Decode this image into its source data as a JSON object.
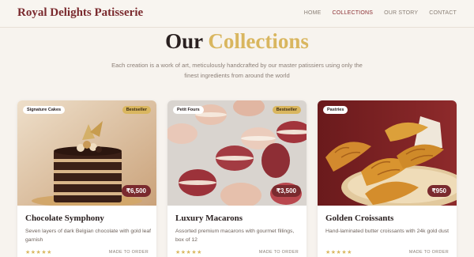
{
  "nav": {
    "brand": "Royal Delights Patisserie",
    "links": [
      {
        "label": "HOME",
        "active": false
      },
      {
        "label": "COLLECTIONS",
        "active": true
      },
      {
        "label": "OUR STORY",
        "active": false
      },
      {
        "label": "CONTACT",
        "active": false
      }
    ]
  },
  "hero": {
    "title_main": "Our",
    "title_accent": "Collections",
    "subtitle": "Each creation is a work of art, meticulously handcrafted by our master patissiers using only the finest ingredients from around the world"
  },
  "colors": {
    "brand": "#7a2a2e",
    "accent_gold": "#d9b65f",
    "background": "#f7f3ee"
  },
  "cards": [
    {
      "category": "Signature Cakes",
      "badge": "Bestseller",
      "price": "₹6,500",
      "name": "Chocolate Symphony",
      "description": "Seven layers of dark Belgian chocolate with gold leaf garnish",
      "rating": 5,
      "stars": "★★★★★",
      "cta": "MADE TO ORDER"
    },
    {
      "category": "Petit Fours",
      "badge": "Bestseller",
      "price": "₹3,500",
      "name": "Luxury Macarons",
      "description": "Assorted premium macarons with gourmet fillings, box of 12",
      "rating": 5,
      "stars": "★★★★★",
      "cta": "MADE TO ORDER"
    },
    {
      "category": "Pastries",
      "badge": "",
      "price": "₹950",
      "name": "Golden Croissants",
      "description": "Hand-laminated butter croissants with 24k gold dust",
      "rating": 5,
      "stars": "★★★★★",
      "cta": "MADE TO ORDER"
    }
  ]
}
